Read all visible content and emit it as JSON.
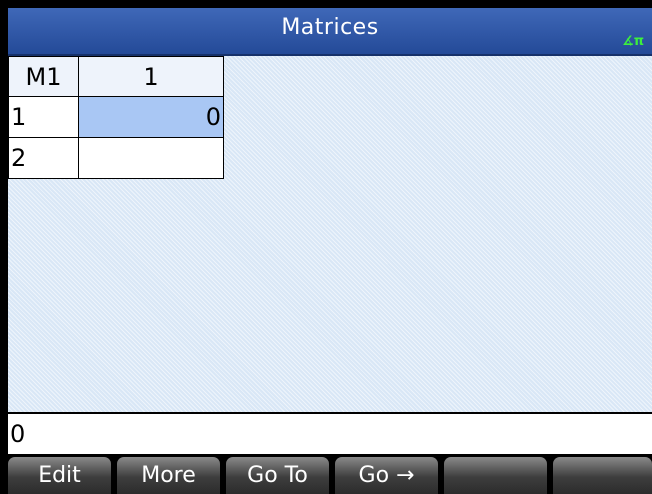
{
  "app": {
    "title": "Matrices",
    "angle_indicator": "∡π"
  },
  "matrix": {
    "name": "M1",
    "column_headers": [
      "1"
    ],
    "rows": [
      {
        "label": "1",
        "cells": [
          "0"
        ]
      },
      {
        "label": "2",
        "cells": [
          ""
        ]
      }
    ],
    "selected_cell": {
      "row": 1,
      "col": 1
    }
  },
  "entry_line": {
    "value": "0"
  },
  "menu": {
    "softkeys": [
      "Edit",
      "More",
      "Go To",
      "Go →",
      "",
      ""
    ]
  },
  "colors": {
    "title_bar": "#2f5aa8",
    "angle_indicator": "#3cf03c",
    "background": "#d9e7f6",
    "selected_cell": "#a9c7f4",
    "softkey": "#555555"
  }
}
